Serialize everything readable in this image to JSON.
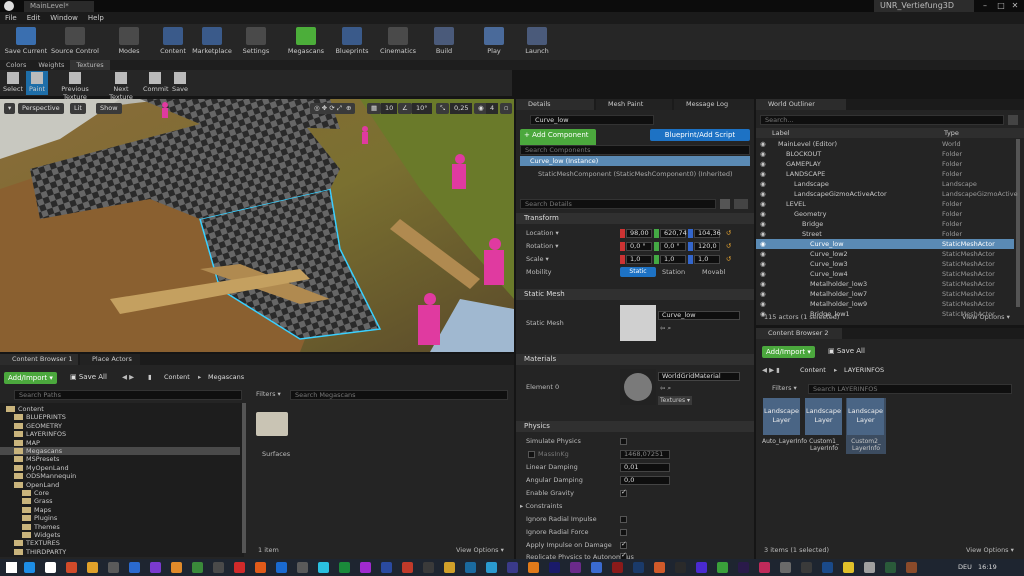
{
  "window": {
    "tab_title": "MainLevel*",
    "project_name": "UNR_Vertiefung3D",
    "min": "–",
    "max": "□",
    "close": "✕"
  },
  "menu": [
    "File",
    "Edit",
    "Window",
    "Help"
  ],
  "toolbar": [
    {
      "label": "Save Current",
      "icon": "save-icon",
      "color": "#3a6fb0"
    },
    {
      "label": "Source Control",
      "icon": "source-control-icon",
      "color": "#4a4a4a"
    },
    {
      "label": "Modes",
      "icon": "modes-icon",
      "color": "#4a4a4a"
    },
    {
      "label": "Content",
      "icon": "content-icon",
      "color": "#3a5a8a"
    },
    {
      "label": "Marketplace",
      "icon": "marketplace-icon",
      "color": "#3a5a8a"
    },
    {
      "label": "Settings",
      "icon": "settings-icon",
      "color": "#4a4a4a"
    },
    {
      "label": "Megascans",
      "icon": "megascans-icon",
      "color": "#4cae3a"
    },
    {
      "label": "Blueprints",
      "icon": "blueprints-icon",
      "color": "#3a5a8a"
    },
    {
      "label": "Cinematics",
      "icon": "cinematics-icon",
      "color": "#4a4a4a"
    },
    {
      "label": "Build",
      "icon": "build-icon",
      "color": "#4a5a7a"
    },
    {
      "label": "Play",
      "icon": "play-icon",
      "color": "#4a6a9a"
    },
    {
      "label": "Launch",
      "icon": "launch-icon",
      "color": "#4a5a7a"
    }
  ],
  "mode_tabs": [
    "Colors",
    "Weights",
    "Textures"
  ],
  "paint_tools": [
    "Select",
    "Paint",
    "Previous Texture",
    "Next Texture",
    "Commit",
    "Save"
  ],
  "viewport": {
    "perspective": "Perspective",
    "lit": "Lit",
    "show": "Show",
    "grid_snap": "10",
    "rot_snap": "10°",
    "scale_snap": "0,25",
    "cam_speed": "4"
  },
  "details": {
    "tabs": [
      "Details",
      "Mesh Paint",
      "Message Log"
    ],
    "name_value": "Curve_low",
    "add_component": "+ Add Component ▾",
    "blueprint_btn": "Blueprint/Add Script",
    "search_components": "Search Components",
    "components": [
      "Curve_low (Instance)",
      "StaticMeshComponent (StaticMeshComponent0) (Inherited)"
    ],
    "search_details": "Search Details",
    "transform": {
      "title": "Transform",
      "location_label": "Location ▾",
      "rotation_label": "Rotation ▾",
      "scale_label": "Scale ▾",
      "mobility_label": "Mobility",
      "location": [
        "98,00",
        "620,74",
        "104,36"
      ],
      "rotation": [
        "0,0 °",
        "0,0 °",
        "120,0"
      ],
      "scale": [
        "1,0",
        "1,0",
        "1,0"
      ],
      "mobility": [
        "Static",
        "Station",
        "Movabl"
      ]
    },
    "static_mesh": {
      "title": "Static Mesh",
      "label": "Static Mesh",
      "value": "Curve_low"
    },
    "materials": {
      "title": "Materials",
      "element_label": "Element 0",
      "value": "WorldGridMaterial",
      "textures_btn": "Textures ▾"
    },
    "physics": {
      "title": "Physics",
      "simulate": "Simulate Physics",
      "mass": "MassInKg",
      "mass_value": "1468,07251",
      "linear_damping": "Linear Damping",
      "linear_value": "0,01",
      "angular_damping": "Angular Damping",
      "angular_value": "0,0",
      "gravity": "Enable Gravity",
      "constraints": "Constraints",
      "ign_impulse": "Ignore Radial Impulse",
      "ign_force": "Ignore Radial Force",
      "apply_impulse": "Apply Impulse on Damage",
      "replicate": "Replicate Physics to Autonomous"
    }
  },
  "outliner": {
    "tab": "World Outliner",
    "search": "Search...",
    "col_label": "Label",
    "col_type": "Type",
    "rows": [
      {
        "indent": 1,
        "name": "MainLevel (Editor)",
        "type": "World"
      },
      {
        "indent": 2,
        "name": "BLOCKOUT",
        "type": "Folder"
      },
      {
        "indent": 2,
        "name": "GAMEPLAY",
        "type": "Folder"
      },
      {
        "indent": 2,
        "name": "LANDSCAPE",
        "type": "Folder"
      },
      {
        "indent": 3,
        "name": "Landscape",
        "type": "Landscape"
      },
      {
        "indent": 3,
        "name": "LandscapeGizmoActiveActor",
        "type": "LandscapeGizmoActive"
      },
      {
        "indent": 2,
        "name": "LEVEL",
        "type": "Folder"
      },
      {
        "indent": 3,
        "name": "Geometry",
        "type": "Folder"
      },
      {
        "indent": 4,
        "name": "Bridge",
        "type": "Folder"
      },
      {
        "indent": 4,
        "name": "Street",
        "type": "Folder"
      },
      {
        "indent": 5,
        "name": "Curve_low",
        "type": "StaticMeshActor",
        "selected": true
      },
      {
        "indent": 5,
        "name": "Curve_low2",
        "type": "StaticMeshActor"
      },
      {
        "indent": 5,
        "name": "Curve_low3",
        "type": "StaticMeshActor"
      },
      {
        "indent": 5,
        "name": "Curve_low4",
        "type": "StaticMeshActor"
      },
      {
        "indent": 5,
        "name": "Metalholder_low3",
        "type": "StaticMeshActor"
      },
      {
        "indent": 5,
        "name": "Metalholder_low7",
        "type": "StaticMeshActor"
      },
      {
        "indent": 5,
        "name": "Metalholder_low9",
        "type": "StaticMeshActor"
      },
      {
        "indent": 5,
        "name": "Bridge_low1",
        "type": "StaticMeshActor"
      }
    ],
    "count": "115 actors (1 selected)",
    "view_options": "View Options ▾"
  },
  "content_browser_1": {
    "tabs": [
      "Content Browser 1",
      "Place Actors"
    ],
    "add_import": "Add/Import ▾",
    "save_all": "Save All",
    "path": [
      "Content",
      "Megascans"
    ],
    "search_paths": "Search Paths",
    "filters": "Filters ▾",
    "search_assets": "Search Megascans",
    "tree": [
      {
        "indent": 0,
        "name": "Content"
      },
      {
        "indent": 1,
        "name": "BLUEPRINTS"
      },
      {
        "indent": 1,
        "name": "GEOMETRY"
      },
      {
        "indent": 1,
        "name": "LAYERINFOS"
      },
      {
        "indent": 1,
        "name": "MAP"
      },
      {
        "indent": 1,
        "name": "Megascans",
        "selected": true
      },
      {
        "indent": 1,
        "name": "MSPresets"
      },
      {
        "indent": 1,
        "name": "MyOpenLand"
      },
      {
        "indent": 1,
        "name": "ODSMannequin"
      },
      {
        "indent": 1,
        "name": "OpenLand"
      },
      {
        "indent": 2,
        "name": "Core"
      },
      {
        "indent": 2,
        "name": "Grass"
      },
      {
        "indent": 2,
        "name": "Maps"
      },
      {
        "indent": 2,
        "name": "Plugins"
      },
      {
        "indent": 2,
        "name": "Themes"
      },
      {
        "indent": 2,
        "name": "Widgets"
      },
      {
        "indent": 1,
        "name": "TEXTURES"
      },
      {
        "indent": 1,
        "name": "THIRDPARTY"
      }
    ],
    "asset": "Surfaces",
    "item_count": "1 item",
    "view_options": "View Options ▾"
  },
  "content_browser_2": {
    "tab": "Content Browser 2",
    "add_import": "Add/Import ▾",
    "save_all": "Save All",
    "path": [
      "Content",
      "LAYERINFOS"
    ],
    "filters": "Filters ▾",
    "search": "Search LAYERINFOS",
    "assets": [
      {
        "thumb": "Landscape Layer",
        "name": "Auto_LayerInfo"
      },
      {
        "thumb": "Landscape Layer",
        "name": "Custom1_ LayerInfo"
      },
      {
        "thumb": "Landscape Layer",
        "name": "Custom2_ LayerInfo"
      }
    ],
    "count": "3 items (1 selected)",
    "view_options": "View Options ▾"
  },
  "taskbar": {
    "lang": "DEU",
    "time": "16:19",
    "icons": [
      "#1d8ee8",
      "#ffffff",
      "#d04a2a",
      "#e0a12a",
      "#5a5a5a",
      "#2a6ad0",
      "#7a3ad0",
      "#e08a2a",
      "#3a8a3a",
      "#4a4a4a",
      "#d02a2a",
      "#e05a1a",
      "#1a6ad0",
      "#5a5a5a",
      "#2ac0e0",
      "#1a8a3a",
      "#a02ad0",
      "#2a4aa0",
      "#c03a2a",
      "#3a3a3a",
      "#d0a02a",
      "#1a6aa0",
      "#2a9ad0",
      "#3a3a8a",
      "#e07a1a",
      "#1a1a6a",
      "#6a2a8a",
      "#3a6ad0",
      "#8a1a1a",
      "#1a3a6a",
      "#d05a2a",
      "#2a2a2a",
      "#4a2ad0",
      "#3aa03a",
      "#2a1a4a",
      "#c02a5a",
      "#6a6a6a",
      "#3a3a3a",
      "#1a4a8a",
      "#e0c02a",
      "#a0a0a0",
      "#2a5a3a",
      "#8a4a2a"
    ]
  }
}
